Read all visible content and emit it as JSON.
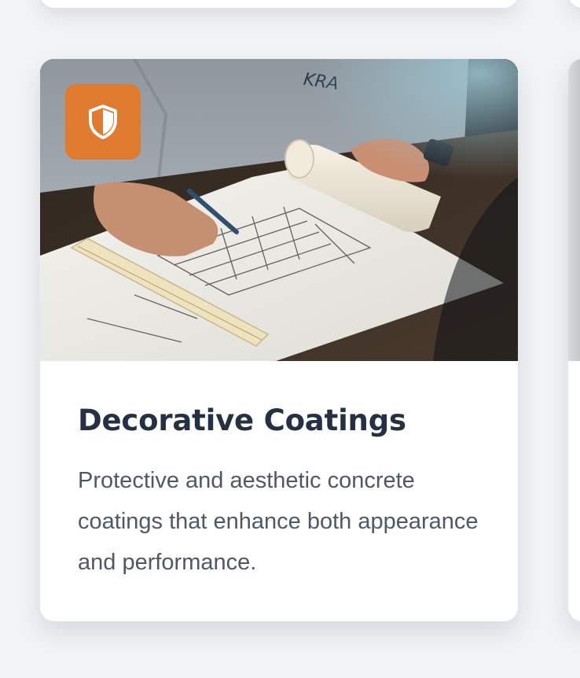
{
  "card": {
    "title": "Decorative Coatings",
    "description": "Protective and aesthetic concrete coatings that enhance both appearance and performance.",
    "badge_icon": "shield-icon",
    "image_subject": "architect-drawing-blueprint-photo",
    "image_shirt_text": "KRA"
  },
  "colors": {
    "badge_accent": "#e07a2e",
    "title": "#243142",
    "description": "#4f5868",
    "background": "#f1f3f5"
  }
}
